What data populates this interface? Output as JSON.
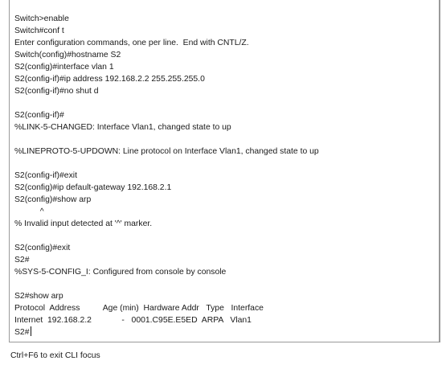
{
  "cli": {
    "lines": [
      "Switch>enable",
      "Switch#conf t",
      "Enter configuration commands, one per line.  End with CNTL/Z.",
      "Switch(config)#hostname S2",
      "S2(config)#interface vlan 1",
      "S2(config-if)#ip address 192.168.2.2 255.255.255.0",
      "S2(config-if)#no shut d",
      "",
      "S2(config-if)#",
      "%LINK-5-CHANGED: Interface Vlan1, changed state to up",
      "",
      "%LINEPROTO-5-UPDOWN: Line protocol on Interface Vlan1, changed state to up",
      "",
      "S2(config-if)#exit",
      "S2(config)#ip default-gateway 192.168.2.1",
      "S2(config)#show arp",
      "           ^",
      "% Invalid input detected at '^' marker.",
      "",
      "S2(config)#exit",
      "S2#",
      "%SYS-5-CONFIG_I: Configured from console by console",
      "",
      "S2#show arp",
      "Protocol  Address          Age (min)  Hardware Addr   Type   Interface",
      "Internet  192.168.2.2             -   0001.C95E.E5ED  ARPA   Vlan1"
    ],
    "prompt": "S2#"
  },
  "footer": {
    "hint": "Ctrl+F6 to exit CLI focus"
  }
}
